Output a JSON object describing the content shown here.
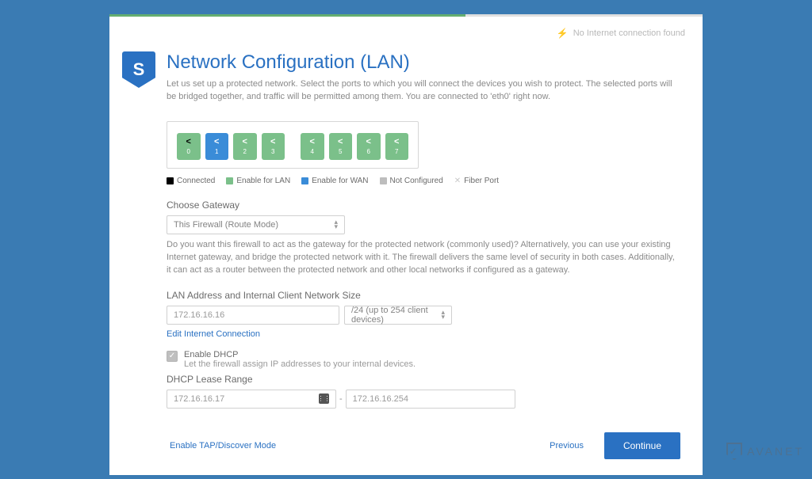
{
  "status": {
    "text": "No Internet connection found"
  },
  "logo_letter": "S",
  "header": {
    "title": "Network Configuration (LAN)",
    "lead": "Let us set up a protected network. Select the ports to which you will connect the devices you wish to protect. The selected ports will be bridged together, and traffic will be permitted among them. You are connected to 'eth0' right now."
  },
  "ports": [
    {
      "id": "0",
      "state": "connected",
      "color": "green"
    },
    {
      "id": "1",
      "state": "wan",
      "color": "blue"
    },
    {
      "id": "2",
      "state": "lan",
      "color": "green"
    },
    {
      "id": "3",
      "state": "lan",
      "color": "green"
    },
    {
      "id": "4",
      "state": "lan",
      "color": "green"
    },
    {
      "id": "5",
      "state": "lan",
      "color": "green"
    },
    {
      "id": "6",
      "state": "lan",
      "color": "green"
    },
    {
      "id": "7",
      "state": "lan",
      "color": "green"
    }
  ],
  "legend": {
    "connected": "Connected",
    "lan": "Enable for LAN",
    "wan": "Enable for WAN",
    "notconfigured": "Not Configured",
    "fiber": "Fiber Port"
  },
  "gateway": {
    "label": "Choose Gateway",
    "value": "This Firewall (Route Mode)",
    "help": "Do you want this firewall to act as the gateway for the protected network (commonly used)? Alternatively, you can use your existing Internet gateway, and bridge the protected network with it. The firewall delivers the same level of security in both cases. Additionally, it can act as a router between the protected network and other local networks if configured as a gateway."
  },
  "lan": {
    "label": "LAN Address and Internal Client Network Size",
    "address": "172.16.16.16",
    "mask": "/24 (up to 254 client devices)",
    "edit_link": "Edit Internet Connection"
  },
  "dhcp": {
    "title": "Enable DHCP",
    "desc": "Let the firewall assign IP addresses to your internal devices.",
    "range_label": "DHCP Lease Range",
    "from": "172.16.16.17",
    "to": "172.16.16.254"
  },
  "footer": {
    "tap_link": "Enable TAP/Discover Mode",
    "previous": "Previous",
    "continue": "Continue"
  },
  "watermark": "AVANET",
  "icons": {
    "share": "share-icon",
    "plug": "plug-icon",
    "calc": "calc-icon",
    "chevron": "chevron-updown-icon",
    "check": "check-icon"
  }
}
